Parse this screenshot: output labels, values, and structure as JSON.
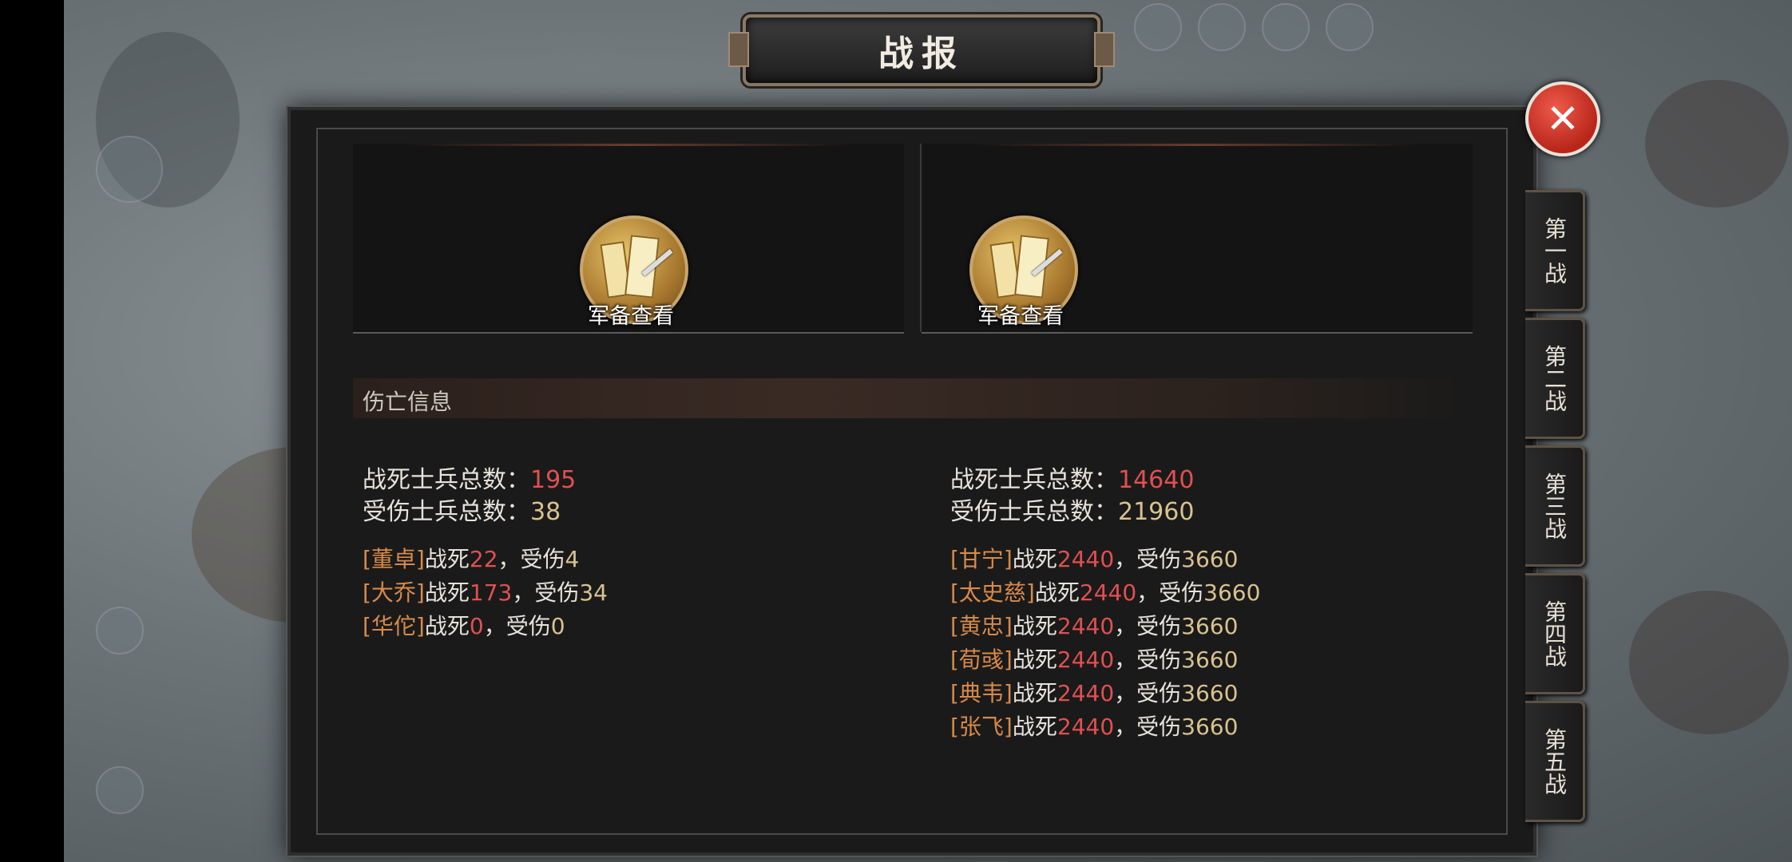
{
  "title": "战报",
  "close_icon": "✕",
  "left": {
    "equip_label": "军备查看",
    "killed_label": "战死士兵总数：",
    "killed": "195",
    "wounded_label": "受伤士兵总数：",
    "wounded": "38",
    "generals": [
      {
        "name": "[董卓]",
        "killed_label": "战死",
        "killed": "22",
        "wounded_label": "，受伤",
        "wounded": "4"
      },
      {
        "name": "[大乔]",
        "killed_label": "战死",
        "killed": "173",
        "wounded_label": "，受伤",
        "wounded": "34"
      },
      {
        "name": "[华佗]",
        "killed_label": "战死",
        "killed": "0",
        "wounded_label": "，受伤",
        "wounded": "0"
      }
    ]
  },
  "right": {
    "equip_label": "军备查看",
    "killed_label": "战死士兵总数：",
    "killed": "14640",
    "wounded_label": "受伤士兵总数：",
    "wounded": "21960",
    "generals": [
      {
        "name": "[甘宁]",
        "killed_label": "战死",
        "killed": "2440",
        "wounded_label": "，受伤",
        "wounded": "3660"
      },
      {
        "name": "[太史慈]",
        "killed_label": "战死",
        "killed": "2440",
        "wounded_label": "，受伤",
        "wounded": "3660"
      },
      {
        "name": "[黄忠]",
        "killed_label": "战死",
        "killed": "2440",
        "wounded_label": "，受伤",
        "wounded": "3660"
      },
      {
        "name": "[荀彧]",
        "killed_label": "战死",
        "killed": "2440",
        "wounded_label": "，受伤",
        "wounded": "3660"
      },
      {
        "name": "[典韦]",
        "killed_label": "战死",
        "killed": "2440",
        "wounded_label": "，受伤",
        "wounded": "3660"
      },
      {
        "name": "[张飞]",
        "killed_label": "战死",
        "killed": "2440",
        "wounded_label": "，受伤",
        "wounded": "3660"
      }
    ]
  },
  "section_title": "伤亡信息",
  "tabs": [
    "第一战",
    "第二战",
    "第三战",
    "第四战",
    "第五战"
  ]
}
